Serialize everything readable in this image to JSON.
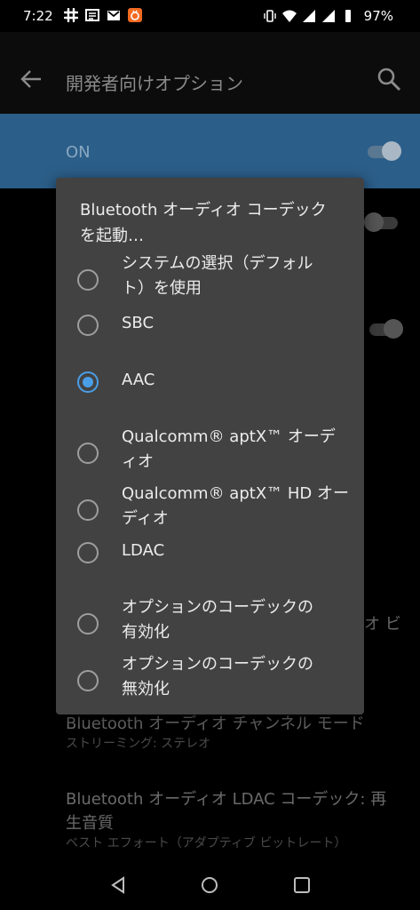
{
  "status_bar": {
    "time": "7:22",
    "battery": "97%",
    "icons_left": [
      "slack-icon",
      "news-icon",
      "gmail-icon",
      "app-icon"
    ],
    "icons_right": [
      "vibrate-icon",
      "wifi-icon",
      "signal-icon",
      "signal-icon",
      "battery-icon"
    ]
  },
  "app_bar": {
    "title": "開発者向けオプション"
  },
  "master_switch": {
    "label": "ON",
    "on": true
  },
  "background_items": [
    {
      "title": "オ ビ",
      "subtitle": ""
    },
    {
      "title": "Bluetooth オーディオ チャンネル モード",
      "subtitle": "ストリーミング: ステレオ"
    },
    {
      "title": "Bluetooth オーディオ LDAC コーデック: 再",
      "title2": "生音質",
      "subtitle": "ベスト エフォート（アダプティブ ビットレート）"
    }
  ],
  "dialog": {
    "title": "Bluetooth オーディオ コーデック を起動…",
    "options": [
      {
        "line1": "システムの選択（デフォル",
        "line2": "ト）を使用",
        "checked": false
      },
      {
        "line1": "SBC",
        "line2": "",
        "checked": false
      },
      {
        "line1": "AAC",
        "line2": "",
        "checked": true
      },
      {
        "line1": "Qualcomm® aptX™ オーデ",
        "line2": "ィオ",
        "checked": false
      },
      {
        "line1": "Qualcomm® aptX™ HD オー",
        "line2": "ディオ",
        "checked": false
      },
      {
        "line1": "LDAC",
        "line2": "",
        "checked": false
      },
      {
        "line1": "オプションのコーデックの",
        "line2": "有効化",
        "checked": false
      },
      {
        "line1": "オプションのコーデックの",
        "line2": "無効化",
        "checked": false
      }
    ]
  },
  "colors": {
    "accent": "#4a9ee8",
    "on_row": "#2b5e89",
    "dialog_bg": "#424242"
  }
}
